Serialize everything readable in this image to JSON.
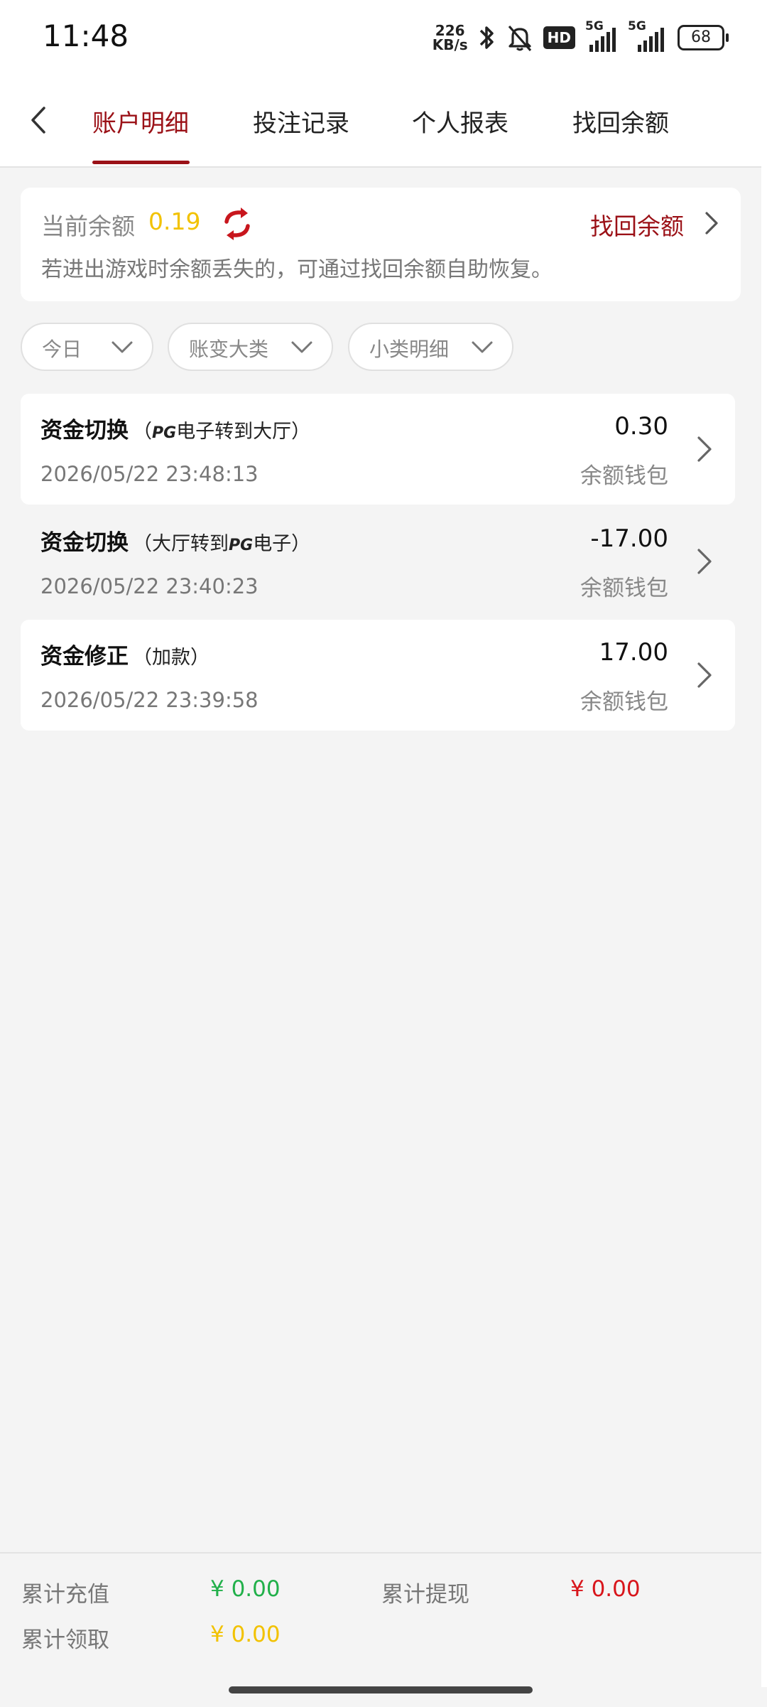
{
  "status": {
    "time": "11:48",
    "netspeed_value": "226",
    "netspeed_unit": "KB/s",
    "hd_label": "HD",
    "sim1_label": "5G",
    "sim2_label": "5G",
    "battery": "68",
    "icons": [
      "bluetooth-icon",
      "bell-off-icon",
      "signal-icon",
      "battery-icon"
    ]
  },
  "tabs": [
    {
      "label": "账户明细",
      "active": true
    },
    {
      "label": "投注记录",
      "active": false
    },
    {
      "label": "个人报表",
      "active": false
    },
    {
      "label": "找回余额",
      "active": false
    }
  ],
  "balance": {
    "label": "当前余额",
    "amount": "0.19",
    "recover_link": "找回余额",
    "hint": "若进出游戏时余额丢失的，可通过找回余额自助恢复。"
  },
  "filters": [
    {
      "label": "今日"
    },
    {
      "label": "账变大类"
    },
    {
      "label": "小类明细"
    }
  ],
  "records": [
    {
      "title": "资金切换",
      "sub_pre": "（",
      "sub_brand": "PG",
      "sub_post": "电子转到大厅）",
      "date": "2026/05/22 23:48:13",
      "amount": "0.30",
      "wallet": "余额钱包"
    },
    {
      "title": "资金切换",
      "sub_pre": "（大厅转到",
      "sub_brand": "PG",
      "sub_post": "电子）",
      "date": "2026/05/22 23:40:23",
      "amount": "-17.00",
      "wallet": "余额钱包"
    },
    {
      "title": "资金修正",
      "sub_pre": "（加款）",
      "sub_brand": "",
      "sub_post": "",
      "date": "2026/05/22 23:39:58",
      "amount": "17.00",
      "wallet": "余额钱包"
    }
  ],
  "footer": {
    "recharge_label": "累计充值",
    "recharge_value": "¥ 0.00",
    "withdraw_label": "累计提现",
    "withdraw_value": "¥ 0.00",
    "claim_label": "累计领取",
    "claim_value": "¥ 0.00"
  },
  "colors": {
    "brand": "#9b1117",
    "balance": "#f2c200",
    "recharge": "#21b04a",
    "withdraw": "#d8151b",
    "claim": "#f2c200"
  }
}
